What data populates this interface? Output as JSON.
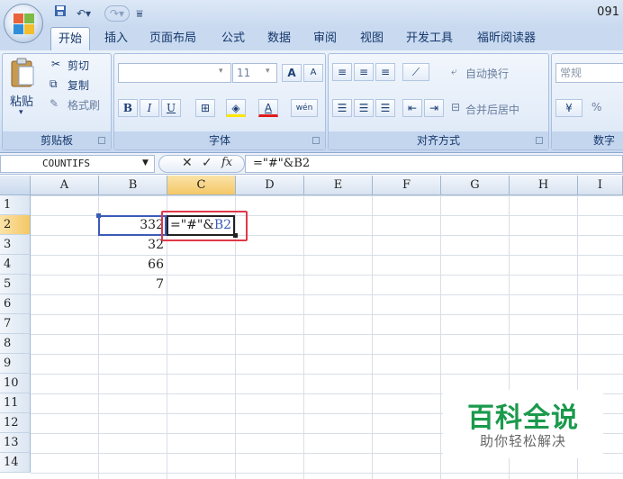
{
  "window": {
    "title_fragment": "091"
  },
  "quick_access": {
    "save_icon": "save-icon",
    "undo_icon": "undo-icon",
    "redo_icon": "redo-icon",
    "customize_icon": "customize-icon"
  },
  "tabs": [
    {
      "label": "开始",
      "active": true
    },
    {
      "label": "插入"
    },
    {
      "label": "页面布局"
    },
    {
      "label": "公式"
    },
    {
      "label": "数据"
    },
    {
      "label": "审阅"
    },
    {
      "label": "视图"
    },
    {
      "label": "开发工具"
    },
    {
      "label": "福昕阅读器"
    }
  ],
  "clipboard": {
    "label": "剪贴板",
    "paste": "粘贴",
    "cut": "剪切",
    "copy": "复制",
    "format_painter": "格式刷"
  },
  "font": {
    "label": "字体",
    "font_name": "",
    "font_size": "11",
    "bold": "B",
    "italic": "I",
    "underline": "U",
    "grow": "A",
    "shrink": "A",
    "font_color": "A",
    "phonetic": "wén"
  },
  "alignment": {
    "label": "对齐方式",
    "wrap": "自动换行",
    "merge": "合并后居中"
  },
  "number": {
    "label": "数字",
    "format": "常规",
    "percent": "%"
  },
  "formula_bar": {
    "name_box": "COUNTIFS",
    "cancel": "✕",
    "enter": "✓",
    "fx": "fx",
    "content": "=\"#\"&B2"
  },
  "columns": [
    "A",
    "B",
    "C",
    "D",
    "E",
    "F",
    "G",
    "H",
    "I"
  ],
  "selected_column": "C",
  "rows": [
    "1",
    "2",
    "3",
    "4",
    "5",
    "6",
    "7",
    "8",
    "9",
    "10",
    "11",
    "12",
    "13",
    "14"
  ],
  "selected_row": "2",
  "cells": {
    "B2": "332",
    "B3": "32",
    "B4": "66",
    "B5": "7",
    "C2": {
      "prefix": "=\"#\"&",
      "ref": "B2"
    }
  },
  "colors": {
    "highlight": "#e0394a",
    "range_ref": "#3b5bb7",
    "watermark": "#1a9a4c"
  },
  "watermark": {
    "title": "百科全说",
    "subtitle": "助你轻松解决"
  }
}
